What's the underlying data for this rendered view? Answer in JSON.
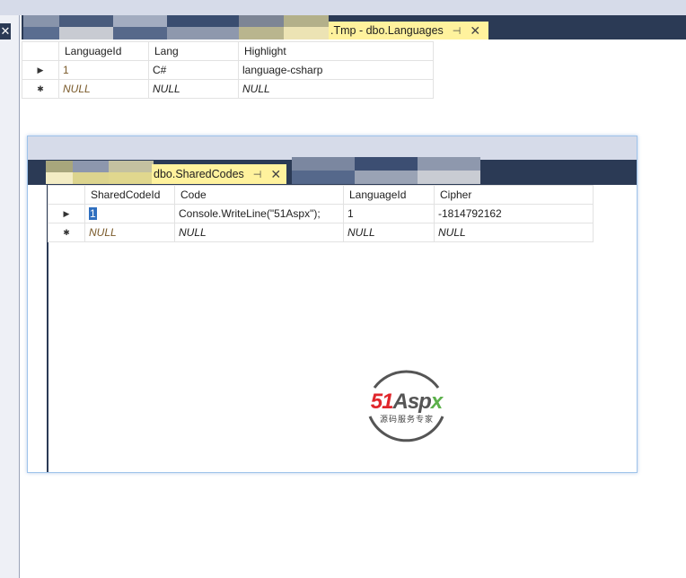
{
  "tab1": {
    "title": ".Tmp - dbo.Languages",
    "pin": "⊣",
    "close": "✕"
  },
  "grid1": {
    "columns": [
      "LanguageId",
      "Lang",
      "Highlight"
    ],
    "rows": [
      {
        "marker": "▶",
        "cells": [
          "1",
          "C#",
          "language-csharp"
        ]
      },
      {
        "marker": "✱",
        "cells": [
          "NULL",
          "NULL",
          "NULL"
        ]
      }
    ]
  },
  "tab2": {
    "title": "dbo.SharedCodes",
    "pin": "⊣",
    "close": "✕"
  },
  "grid2": {
    "columns": [
      "SharedCodeId",
      "Code",
      "LanguageId",
      "Cipher"
    ],
    "rows": [
      {
        "marker": "▶",
        "cells": [
          "1",
          "Console.WriteLine(\"51Aspx\");",
          "1",
          "-1814792162"
        ]
      },
      {
        "marker": "✱",
        "cells": [
          "NULL",
          "NULL",
          "NULL",
          "NULL"
        ]
      }
    ]
  },
  "left_close": "✕",
  "watermark": {
    "brand": "51Aspx",
    "tagline": "源码服务专家"
  }
}
